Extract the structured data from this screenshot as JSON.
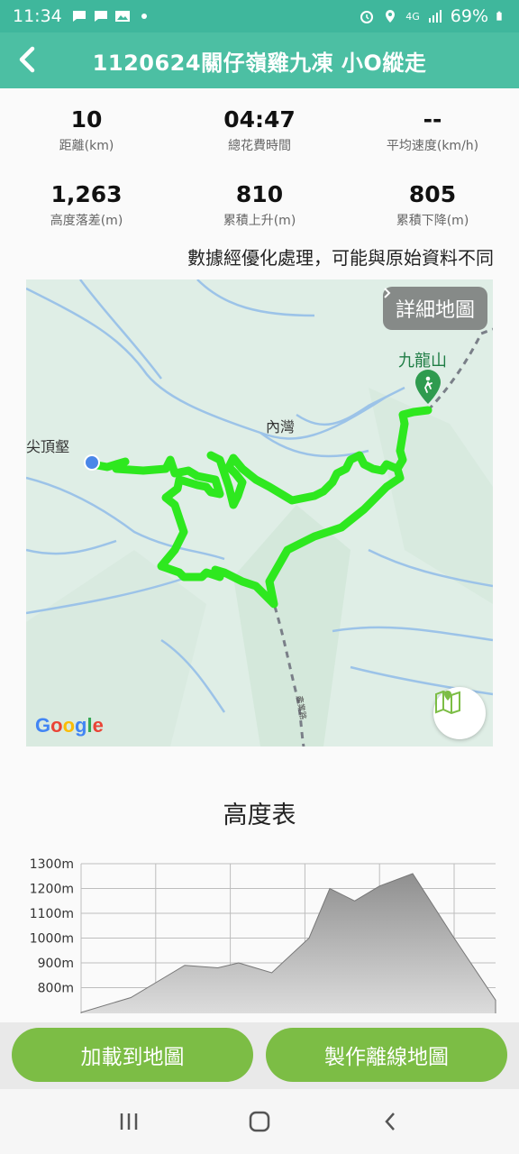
{
  "status": {
    "time": "11:34",
    "network": "4G",
    "battery": "69%"
  },
  "header": {
    "title": "1120624關仔嶺雞九凍 小O縱走"
  },
  "stats": [
    {
      "value": "10",
      "label": "距離(km)"
    },
    {
      "value": "04:47",
      "label": "總花費時間"
    },
    {
      "value": "--",
      "label": "平均速度(km/h)"
    },
    {
      "value": "1,263",
      "label": "高度落差(m)"
    },
    {
      "value": "810",
      "label": "累積上升(m)"
    },
    {
      "value": "805",
      "label": "累積下降(m)"
    }
  ],
  "note": "數據經優化處理，可能與原始資料不同",
  "map": {
    "detail_button": "詳細地圖",
    "labels": {
      "peak": "九龍山",
      "village": "內灣",
      "left_peak": "尖頂壑"
    },
    "google": "Google",
    "route_color": "#2ee81f",
    "start_color": "#4a86e8"
  },
  "elevation": {
    "title": "高度表",
    "y_ticks": [
      "1300m",
      "1200m",
      "1100m",
      "1000m",
      "900m",
      "800m"
    ]
  },
  "chart_data": {
    "type": "area",
    "title": "高度表",
    "ylabel": "",
    "xlabel": "",
    "ylim": [
      700,
      1300
    ],
    "y_ticks": [
      1300,
      1200,
      1100,
      1000,
      900,
      800
    ],
    "x": [
      0,
      0.12,
      0.18,
      0.25,
      0.33,
      0.38,
      0.42,
      0.46,
      0.55,
      0.6,
      0.66,
      0.72,
      0.8,
      0.9,
      1.0
    ],
    "values": [
      700,
      760,
      820,
      890,
      880,
      900,
      880,
      860,
      1000,
      1200,
      1150,
      1210,
      1260,
      1000,
      750
    ]
  },
  "actions": {
    "load_to_map": "加載到地圖",
    "make_offline_map": "製作離線地圖"
  }
}
